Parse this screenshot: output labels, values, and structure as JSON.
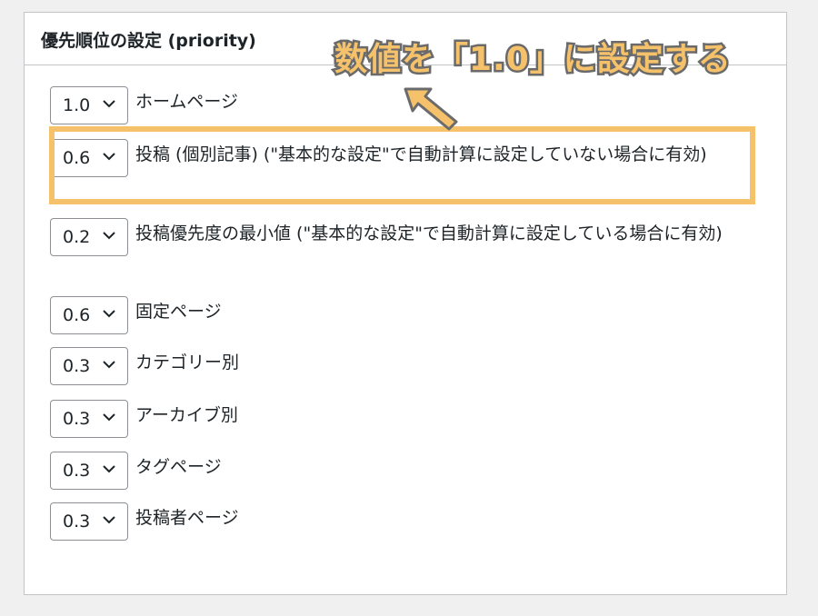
{
  "panel": {
    "title": "優先順位の設定 (priority)"
  },
  "annotation": {
    "text": "数値を「1.0」に設定する",
    "color": "#f5c26b"
  },
  "rows": [
    {
      "value": "1.0",
      "label": "ホームページ"
    },
    {
      "value": "0.6",
      "label": "投稿 (個別記事) (\"基本的な設定\"で自動計算に設定していない場合に有効)"
    },
    {
      "value": "0.2",
      "label": "投稿優先度の最小値 (\"基本的な設定\"で自動計算に設定している場合に有効)"
    },
    {
      "value": "0.6",
      "label": "固定ページ"
    },
    {
      "value": "0.3",
      "label": "カテゴリー別"
    },
    {
      "value": "0.3",
      "label": "アーカイブ別"
    },
    {
      "value": "0.3",
      "label": "タグページ"
    },
    {
      "value": "0.3",
      "label": "投稿者ページ"
    }
  ],
  "icons": {
    "dropdown": "chevron-down-icon",
    "pointer": "arrow-pointer-icon"
  }
}
